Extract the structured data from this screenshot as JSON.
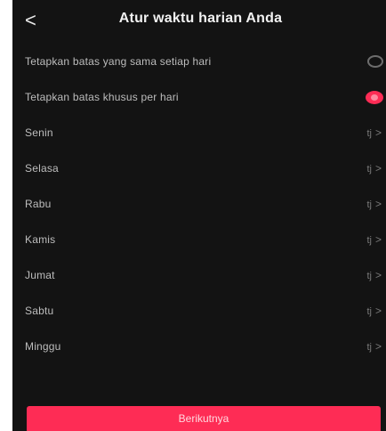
{
  "header": {
    "back_icon": "<",
    "title": "Atur waktu harian Anda"
  },
  "options": {
    "same_limit_label": "Tetapkan batas yang sama setiap hari",
    "same_limit_selected": false,
    "custom_limit_label": "Tetapkan batas khusus per hari",
    "custom_limit_selected": true
  },
  "days": [
    {
      "label": "Senin",
      "value": "tj"
    },
    {
      "label": "Selasa",
      "value": "tj"
    },
    {
      "label": "Rabu",
      "value": "tj"
    },
    {
      "label": "Kamis",
      "value": "tj"
    },
    {
      "label": "Jumat",
      "value": "tj"
    },
    {
      "label": "Sabtu",
      "value": "tj"
    },
    {
      "label": "Minggu",
      "value": "tj"
    }
  ],
  "chevron": ">",
  "footer": {
    "next_label": "Berikutnya"
  },
  "colors": {
    "background": "#131313",
    "accent": "#fe2c55"
  }
}
